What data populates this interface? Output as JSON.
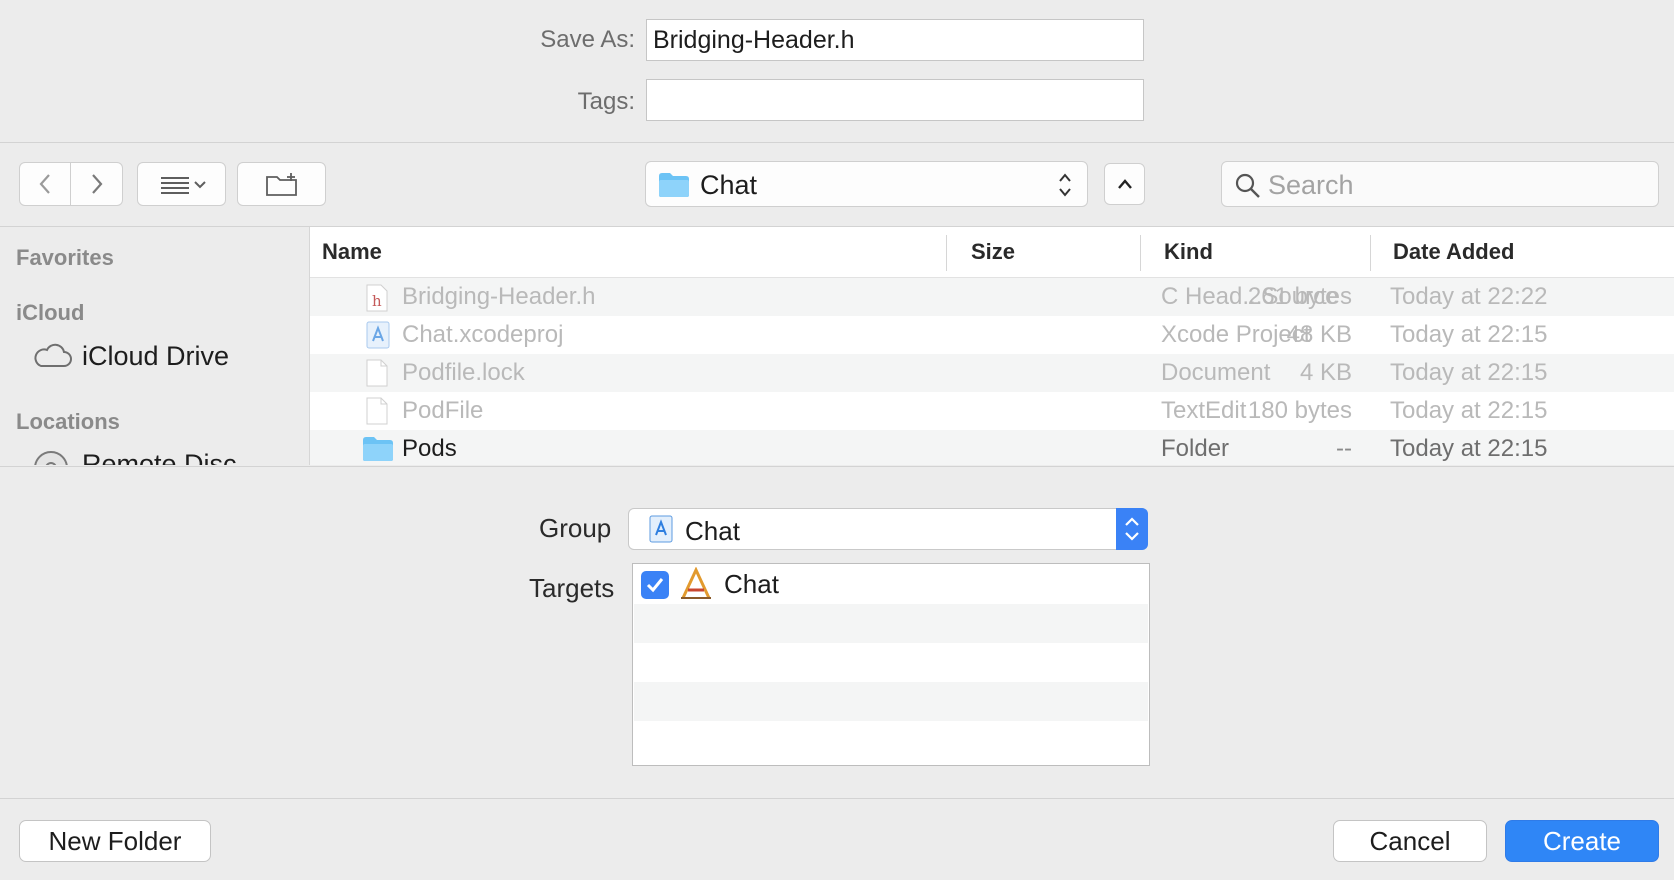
{
  "save_as": {
    "label": "Save As:",
    "value": "Bridging-Header.h"
  },
  "tags": {
    "label": "Tags:",
    "value": ""
  },
  "toolbar": {
    "back_icon": "chevron-left-icon",
    "forward_icon": "chevron-right-icon",
    "view_icon": "list-view-icon",
    "new_folder_icon": "new-folder-icon",
    "location": "Chat",
    "collapse_icon": "chevron-up-icon",
    "search_placeholder": "Search"
  },
  "sidebar": {
    "favorites": "Favorites",
    "icloud": "iCloud",
    "icloud_drive": "iCloud Drive",
    "locations": "Locations",
    "remote_disc": "Remote Disc"
  },
  "columns": {
    "name": "Name",
    "size": "Size",
    "kind": "Kind",
    "date": "Date Added"
  },
  "files": [
    {
      "name": "Bridging-Header.h",
      "size": "261 bytes",
      "kind": "C Head...Source",
      "date": "Today at 22:22",
      "icon": "header-file-icon"
    },
    {
      "name": "Chat.xcodeproj",
      "size": "48 KB",
      "kind": "Xcode Project",
      "date": "Today at 22:15",
      "icon": "xcodeproj-icon"
    },
    {
      "name": "Podfile.lock",
      "size": "4 KB",
      "kind": "Document",
      "date": "Today at 22:15",
      "icon": "document-icon"
    },
    {
      "name": "PodFile",
      "size": "180 bytes",
      "kind": "TextEdit",
      "date": "Today at 22:15",
      "icon": "document-icon"
    },
    {
      "name": "Pods",
      "size": "--",
      "kind": "Folder",
      "date": "Today at 22:15",
      "icon": "folder-icon"
    }
  ],
  "group": {
    "label": "Group",
    "value": "Chat"
  },
  "targets": {
    "label": "Targets",
    "items": [
      {
        "name": "Chat",
        "checked": true
      }
    ]
  },
  "buttons": {
    "new_folder": "New Folder",
    "cancel": "Cancel",
    "create": "Create"
  },
  "colors": {
    "accent": "#2f86f6",
    "folder": "#6cc3f5"
  }
}
